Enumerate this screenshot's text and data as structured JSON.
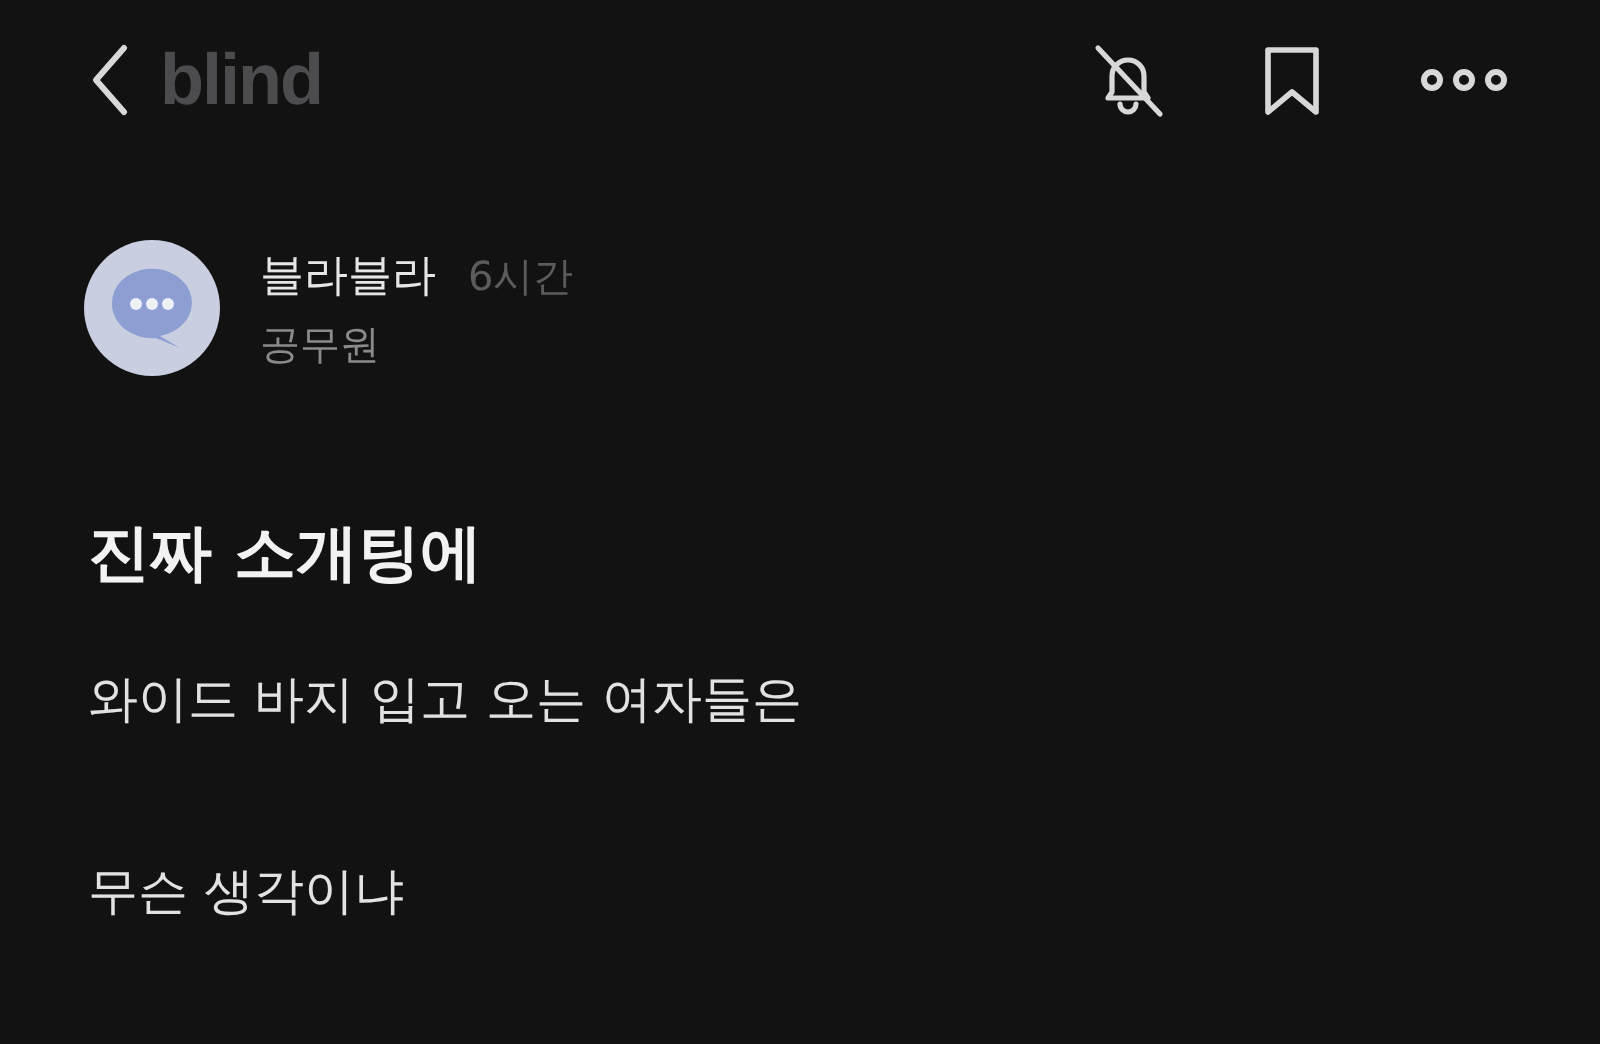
{
  "header": {
    "logo": "blind"
  },
  "post": {
    "author": "블라블라",
    "time": "6시간",
    "company": "공무원",
    "title": "진짜 소개팅에",
    "paragraphs": [
      "와이드 바지 입고 오는 여자들은",
      "무슨 생각이냐"
    ]
  }
}
